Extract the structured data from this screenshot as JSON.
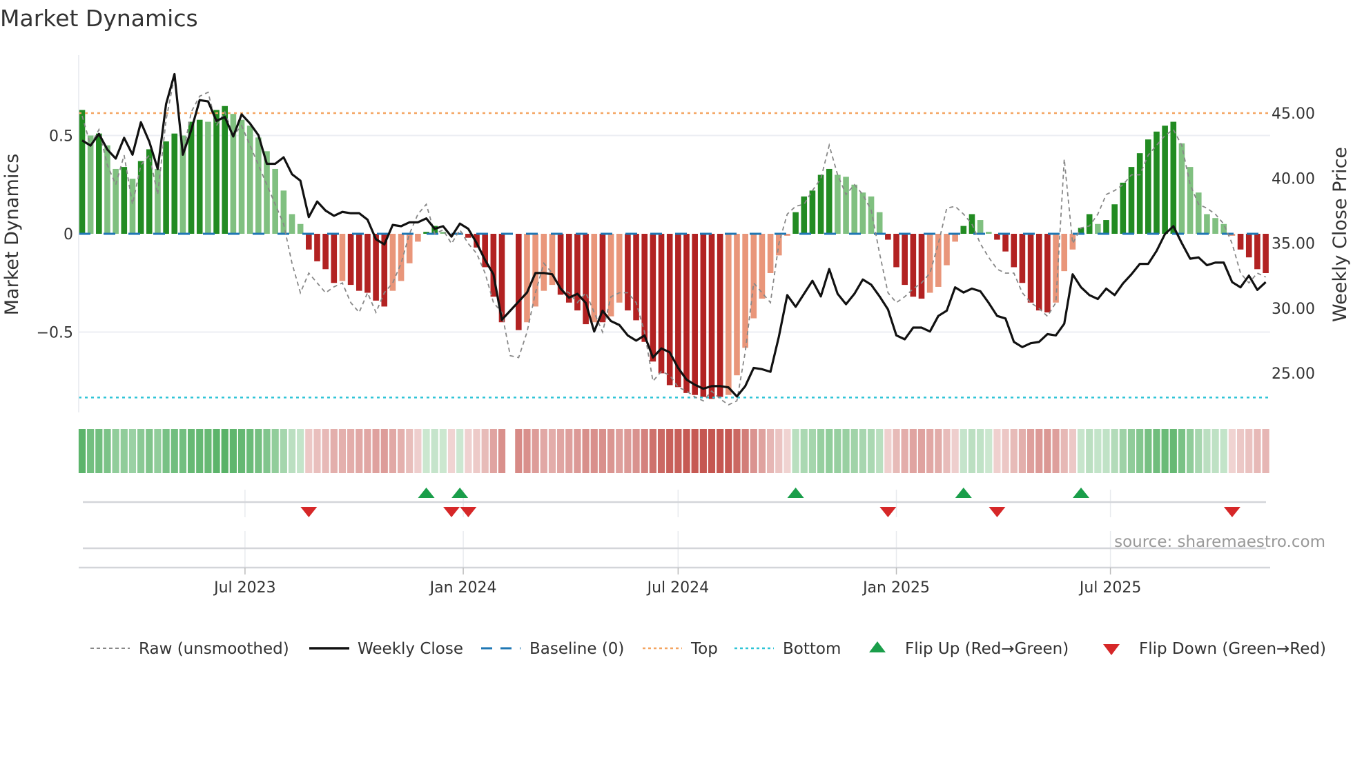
{
  "chart_data": {
    "type": "bar",
    "title": "Market Dynamics",
    "ylabel": "Market Dynamics",
    "y2label": "Weekly Close Price",
    "source": "source: sharemaestro.com",
    "ylim": [
      -0.95,
      0.86
    ],
    "y2lim": [
      21.6,
      57.0
    ],
    "yticks": [
      {
        "v": 0.5,
        "label": "0.5"
      },
      {
        "v": 0,
        "label": "0"
      },
      {
        "v": -0.5,
        "label": "−0.5"
      }
    ],
    "y2ticks": [
      {
        "v": 45,
        "label": "45.00"
      },
      {
        "v": 40,
        "label": "40.00"
      },
      {
        "v": 35,
        "label": "35.00"
      },
      {
        "v": 30,
        "label": "30.00"
      },
      {
        "v": 25,
        "label": "25.00"
      }
    ],
    "xticks": [
      {
        "week": 19.4,
        "label": "Jul 2023"
      },
      {
        "week": 45.4,
        "label": "Jan 2024"
      },
      {
        "week": 71.0,
        "label": "Jul 2024"
      },
      {
        "week": 97.0,
        "label": "Jan 2025"
      },
      {
        "week": 122.5,
        "label": "Jul 2025"
      }
    ],
    "top_level": 0.614,
    "bottom_level": -0.833,
    "baseline": 0,
    "colors": {
      "strong_green": "#228b22",
      "weak_green": "#80c080",
      "strong_red": "#b22222",
      "weak_red": "#e9967a",
      "top": "#f4a460",
      "bottom": "#2ec4d6",
      "baseline": "#1f77b4",
      "flip_up": "#1a9e4a",
      "flip_down": "#d62728"
    },
    "momentum": [
      0.63,
      0.5,
      0.51,
      0.45,
      0.33,
      0.34,
      0.28,
      0.37,
      0.43,
      0.33,
      0.47,
      0.51,
      0.5,
      0.57,
      0.58,
      0.57,
      0.63,
      0.65,
      0.61,
      0.58,
      0.55,
      0.49,
      0.42,
      0.33,
      0.22,
      0.1,
      0.05,
      -0.08,
      -0.14,
      -0.18,
      -0.25,
      -0.24,
      -0.26,
      -0.29,
      -0.3,
      -0.34,
      -0.37,
      -0.29,
      -0.24,
      -0.15,
      -0.04,
      0.01,
      0.04,
      0.01,
      -0.005,
      0.003,
      -0.02,
      -0.07,
      -0.17,
      -0.32,
      -0.45,
      null,
      -0.49,
      -0.45,
      -0.37,
      -0.29,
      -0.26,
      -0.31,
      -0.35,
      -0.39,
      -0.46,
      -0.45,
      -0.45,
      -0.42,
      -0.35,
      -0.39,
      -0.44,
      -0.55,
      -0.65,
      -0.71,
      -0.77,
      -0.78,
      -0.81,
      -0.82,
      -0.83,
      -0.84,
      -0.83,
      -0.82,
      -0.72,
      -0.58,
      -0.43,
      -0.33,
      -0.2,
      -0.11,
      -0.01,
      0.11,
      0.19,
      0.22,
      0.3,
      0.33,
      0.3,
      0.29,
      0.25,
      0.21,
      0.19,
      0.11,
      -0.03,
      -0.17,
      -0.26,
      -0.32,
      -0.33,
      -0.3,
      -0.27,
      -0.16,
      -0.04,
      0.04,
      0.1,
      0.07,
      0.01,
      -0.03,
      -0.09,
      -0.17,
      -0.25,
      -0.35,
      -0.39,
      -0.4,
      -0.35,
      -0.19,
      -0.08,
      0.03,
      0.1,
      0.05,
      0.07,
      0.15,
      0.26,
      0.34,
      0.41,
      0.48,
      0.52,
      0.55,
      0.57,
      0.46,
      0.34,
      0.21,
      0.1,
      0.08,
      0.05,
      -0.01,
      -0.08,
      -0.12,
      -0.18,
      -0.2
    ],
    "strong": [
      1,
      0,
      1,
      0,
      0,
      1,
      0,
      1,
      1,
      0,
      1,
      1,
      0,
      1,
      1,
      0,
      1,
      1,
      0,
      0,
      0,
      0,
      0,
      0,
      0,
      0,
      0,
      1,
      1,
      1,
      1,
      0,
      1,
      1,
      1,
      1,
      1,
      0,
      0,
      0,
      0,
      1,
      1,
      0,
      0,
      0,
      1,
      1,
      1,
      1,
      1,
      0,
      1,
      0,
      0,
      0,
      0,
      1,
      1,
      1,
      1,
      0,
      1,
      0,
      0,
      1,
      1,
      1,
      1,
      1,
      1,
      1,
      1,
      1,
      1,
      1,
      1,
      0,
      0,
      0,
      0,
      0,
      0,
      0,
      0,
      1,
      1,
      1,
      1,
      1,
      0,
      0,
      0,
      0,
      0,
      0,
      1,
      1,
      1,
      1,
      1,
      0,
      0,
      0,
      0,
      1,
      1,
      0,
      0,
      1,
      1,
      1,
      1,
      1,
      1,
      1,
      0,
      0,
      0,
      1,
      1,
      0,
      1,
      1,
      1,
      1,
      1,
      1,
      1,
      1,
      1,
      0,
      0,
      0,
      0,
      0,
      0,
      0,
      1,
      1,
      1,
      1
    ],
    "close": [
      42.9,
      42.5,
      43.4,
      42.2,
      41.5,
      43.1,
      41.8,
      44.3,
      42.8,
      40.7,
      45.7,
      48.0,
      41.8,
      43.7,
      46.0,
      45.9,
      44.4,
      44.7,
      43.2,
      44.9,
      44.2,
      43.3,
      41.1,
      41.1,
      41.6,
      40.3,
      39.8,
      37.0,
      38.2,
      37.5,
      37.1,
      37.4,
      37.3,
      37.3,
      36.8,
      35.3,
      34.9,
      36.4,
      36.3,
      36.6,
      36.6,
      36.9,
      36.1,
      36.3,
      35.5,
      36.5,
      36.1,
      35.0,
      33.7,
      32.6,
      29.1,
      29.8,
      30.5,
      31.2,
      32.7,
      32.7,
      32.6,
      31.5,
      30.8,
      31.1,
      30.4,
      28.2,
      29.8,
      29.0,
      28.7,
      27.9,
      27.5,
      27.9,
      26.2,
      26.9,
      26.6,
      25.4,
      24.5,
      24.1,
      23.8,
      24.0,
      24.0,
      23.9,
      23.2,
      24.0,
      25.4,
      25.3,
      25.1,
      27.8,
      31.0,
      30.1,
      31.1,
      32.1,
      30.9,
      33.0,
      31.1,
      30.3,
      31.1,
      32.2,
      31.8,
      30.9,
      29.9,
      27.9,
      27.6,
      28.5,
      28.5,
      28.2,
      29.4,
      29.8,
      31.6,
      31.2,
      31.5,
      31.3,
      30.4,
      29.4,
      29.2,
      27.4,
      27.0,
      27.3,
      27.4,
      28.0,
      27.9,
      28.8,
      32.6,
      31.6,
      31.0,
      30.7,
      31.5,
      31.0,
      31.9,
      32.6,
      33.4,
      33.4,
      34.4,
      35.7,
      36.3,
      35.0,
      33.8,
      33.9,
      33.3,
      33.5,
      33.5,
      32.0,
      31.6,
      32.5,
      31.4,
      32.0
    ],
    "raw": [
      0.6,
      0.45,
      0.53,
      0.35,
      0.25,
      0.4,
      0.15,
      0.35,
      0.4,
      0.2,
      0.58,
      0.8,
      0.4,
      0.62,
      0.7,
      0.72,
      0.55,
      0.62,
      0.5,
      0.55,
      0.45,
      0.35,
      0.25,
      0.15,
      0.05,
      -0.15,
      -0.3,
      -0.2,
      -0.25,
      -0.3,
      -0.27,
      -0.25,
      -0.35,
      -0.4,
      -0.3,
      -0.4,
      -0.3,
      -0.25,
      -0.15,
      0.0,
      0.1,
      0.15,
      0.0,
      0.02,
      -0.05,
      0.02,
      -0.05,
      -0.1,
      -0.2,
      -0.35,
      -0.4,
      -0.62,
      -0.63,
      -0.5,
      -0.3,
      -0.15,
      -0.2,
      -0.28,
      -0.3,
      -0.35,
      -0.3,
      -0.4,
      -0.5,
      -0.32,
      -0.3,
      -0.3,
      -0.35,
      -0.5,
      -0.75,
      -0.7,
      -0.72,
      -0.78,
      -0.8,
      -0.83,
      -0.85,
      -0.8,
      -0.84,
      -0.87,
      -0.85,
      -0.6,
      -0.25,
      -0.3,
      -0.35,
      -0.05,
      0.1,
      0.14,
      0.15,
      0.22,
      0.28,
      0.45,
      0.3,
      0.2,
      0.25,
      0.2,
      0.12,
      -0.1,
      -0.3,
      -0.35,
      -0.32,
      -0.28,
      -0.25,
      -0.2,
      -0.05,
      0.13,
      0.14,
      0.1,
      0.05,
      -0.05,
      -0.12,
      -0.18,
      -0.2,
      -0.2,
      -0.3,
      -0.35,
      -0.38,
      -0.42,
      -0.35,
      0.38,
      -0.05,
      0.03,
      0.04,
      0.1,
      0.2,
      0.22,
      0.25,
      0.3,
      0.3,
      0.4,
      0.45,
      0.5,
      0.53,
      0.45,
      0.25,
      0.15,
      0.13,
      0.1,
      0.05,
      -0.05,
      -0.2,
      -0.25,
      -0.2,
      -0.22
    ],
    "legend": {
      "position": "bottom",
      "items": [
        {
          "label": "Raw (unsmoothed)"
        },
        {
          "label": "Weekly Close"
        },
        {
          "label": "Baseline (0)"
        },
        {
          "label": "Top"
        },
        {
          "label": "Bottom"
        },
        {
          "label": "Flip Up (Red→Green)"
        },
        {
          "label": "Flip Down (Green→Red)"
        }
      ]
    }
  }
}
